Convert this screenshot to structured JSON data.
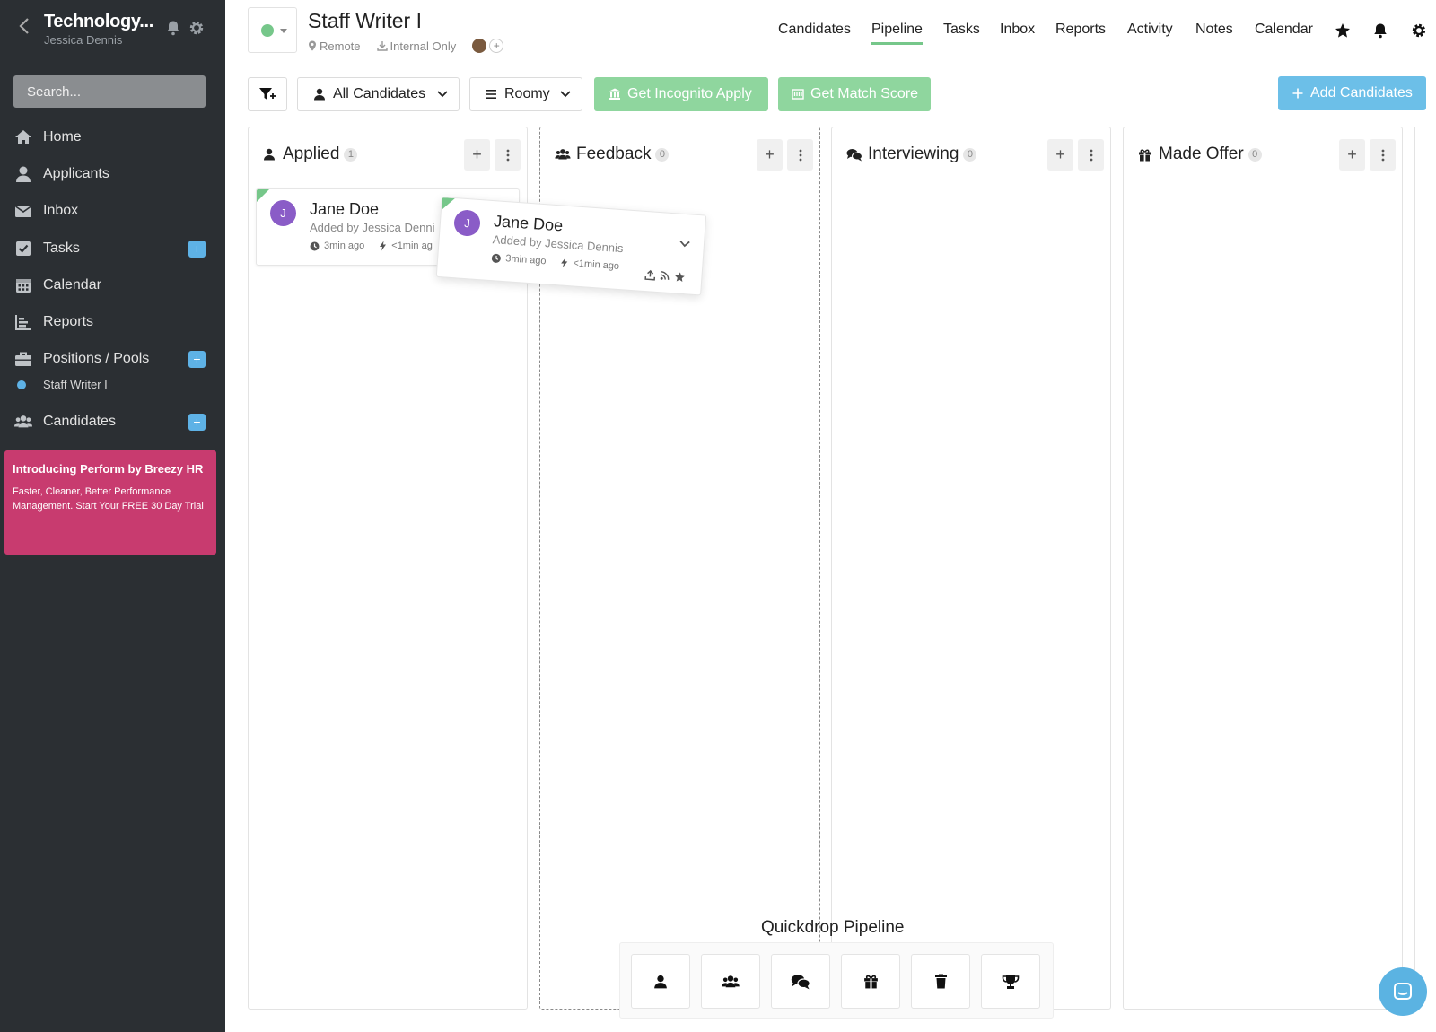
{
  "sidebar": {
    "title": "Technology...",
    "subtitle": "Jessica Dennis",
    "search_placeholder": "Search...",
    "items": [
      {
        "label": "Home",
        "icon": "home-icon"
      },
      {
        "label": "Applicants",
        "icon": "user-icon"
      },
      {
        "label": "Inbox",
        "icon": "envelope-icon"
      },
      {
        "label": "Tasks",
        "icon": "checkbox-icon"
      },
      {
        "label": "Calendar",
        "icon": "calendar-icon"
      },
      {
        "label": "Reports",
        "icon": "chart-icon"
      },
      {
        "label": "Positions / Pools",
        "icon": "briefcase-icon"
      },
      {
        "label": "Candidates",
        "icon": "users-icon"
      }
    ],
    "sub_item": "Staff Writer I",
    "promo": {
      "title": "Introducing Perform by Breezy HR",
      "body": "Faster, Cleaner, Better Performance Management. Start Your FREE 30 Day Trial"
    }
  },
  "header": {
    "position_title": "Staff Writer I",
    "location": "Remote",
    "visibility": "Internal Only",
    "status_color": "#76c78a",
    "nav": [
      "Candidates",
      "Pipeline",
      "Tasks",
      "Inbox",
      "Reports",
      "Activity",
      "Notes",
      "Calendar"
    ],
    "active_nav": "Pipeline"
  },
  "toolbar": {
    "candidates_filter": "All Candidates",
    "view_mode": "Roomy",
    "incognito": "Get Incognito Apply",
    "match_score": "Get Match Score",
    "add": "Add Candidates"
  },
  "columns": [
    {
      "title": "Applied",
      "count": "1",
      "icon": "user-icon"
    },
    {
      "title": "Feedback",
      "count": "0",
      "icon": "users-icon"
    },
    {
      "title": "Interviewing",
      "count": "0",
      "icon": "comments-icon"
    },
    {
      "title": "Made Offer",
      "count": "0",
      "icon": "gift-icon"
    }
  ],
  "card": {
    "initial": "J",
    "name": "Jane Doe",
    "added_by": "Added by Jessica Dennis",
    "added_by_truncated": "Added by Jessica Denni",
    "time_added": "3min ago",
    "last_activity": "<1min ago",
    "last_activity_truncated": "<1min ag"
  },
  "quickdrop": {
    "title": "Quickdrop Pipeline",
    "slots": [
      "user-icon",
      "users-icon",
      "comments-icon",
      "gift-icon",
      "trash-icon",
      "trophy-icon"
    ]
  },
  "colors": {
    "sidebar_bg": "#2b2f33",
    "accent_green": "#76c78a",
    "accent_blue": "#5eb2e6",
    "promo_bg": "#c83b6f",
    "avatar": "#8a5cc7"
  }
}
